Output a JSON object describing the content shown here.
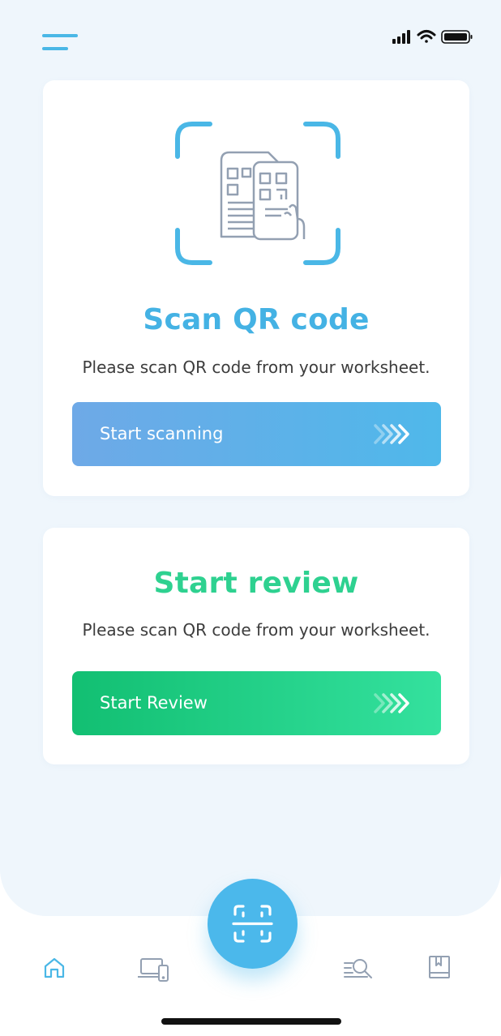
{
  "scan_card": {
    "title": "Scan QR code",
    "subtitle": "Please scan QR code from your worksheet.",
    "button_label": "Start scanning"
  },
  "review_card": {
    "title": "Start review",
    "subtitle": "Please scan QR code from your worksheet.",
    "button_label": "Start Review"
  },
  "bottom_nav": {
    "items": [
      "home-icon",
      "devices-icon",
      "scan-icon",
      "search-list-icon",
      "book-icon"
    ],
    "active": "home-icon"
  },
  "colors": {
    "accent_blue": "#44b2e4",
    "accent_green": "#2ed190",
    "background": "#eff6fc"
  }
}
